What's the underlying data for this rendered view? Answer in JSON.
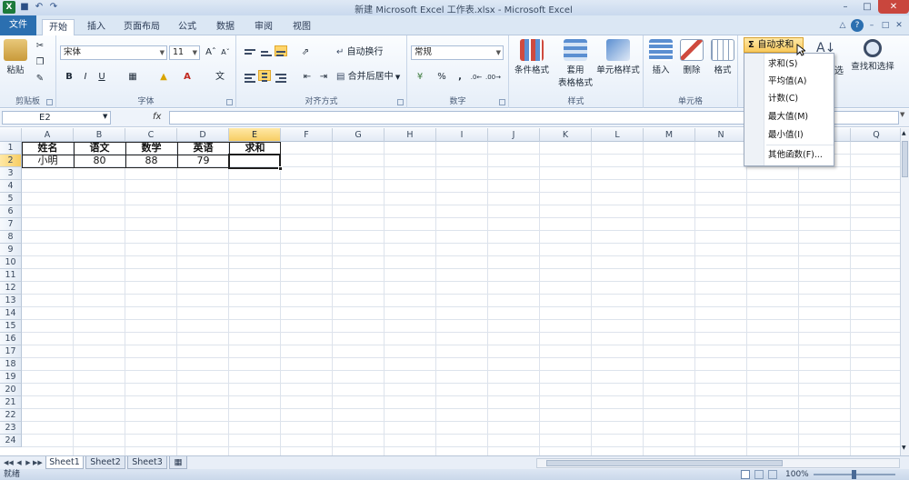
{
  "window": {
    "title": "新建 Microsoft Excel 工作表.xlsx - Microsoft Excel",
    "app_icon": "X",
    "quick_access": [
      "save-icon",
      "undo-icon",
      "redo-icon"
    ]
  },
  "tabs": [
    "文件",
    "开始",
    "插入",
    "页面布局",
    "公式",
    "数据",
    "审阅",
    "视图"
  ],
  "ribbon": {
    "clipboard": {
      "paste": "粘贴",
      "label": "剪贴板"
    },
    "font": {
      "name": "宋体",
      "size": "11",
      "label": "字体",
      "bold": "B",
      "italic": "I",
      "underline": "U"
    },
    "alignment": {
      "wrap": "自动换行",
      "merge": "合并后居中",
      "label": "对齐方式"
    },
    "number": {
      "format": "常规",
      "percent": "%",
      "comma": ",",
      "label": "数字"
    },
    "styles": {
      "conditional": "条件格式",
      "table_1": "套用",
      "table_2": "表格格式",
      "cell_styles": "单元格样式",
      "label": "样式"
    },
    "cells": {
      "insert": "插入",
      "delete": "删除",
      "format": "格式",
      "label": "单元格"
    },
    "editing": {
      "autosum": "自动求和",
      "sort_filter": "选",
      "find_select": "查找和选择"
    }
  },
  "formula_bar": {
    "name_box": "E2",
    "fx": "fx",
    "formula": ""
  },
  "columns": [
    "A",
    "B",
    "C",
    "D",
    "E",
    "F",
    "G",
    "H",
    "I",
    "J",
    "K",
    "L",
    "M",
    "N",
    "O",
    "P",
    "Q"
  ],
  "rows": [
    "1",
    "2",
    "3",
    "4",
    "5",
    "6",
    "7",
    "8",
    "9",
    "10",
    "11",
    "12",
    "13",
    "14",
    "15",
    "16",
    "17",
    "18",
    "19",
    "20",
    "21",
    "22",
    "23",
    "24"
  ],
  "sheet": {
    "headers": [
      "姓名",
      "语文",
      "数学",
      "英语",
      "求和"
    ],
    "row2": [
      "小明",
      "80",
      "88",
      "79",
      ""
    ]
  },
  "autosum_menu": {
    "items": [
      "求和(S)",
      "平均值(A)",
      "计数(C)",
      "最大值(M)",
      "最小值(I)",
      "其他函数(F)..."
    ]
  },
  "sheet_tabs": [
    "Sheet1",
    "Sheet2",
    "Sheet3"
  ],
  "status": {
    "mode": "就绪",
    "zoom": "100%"
  },
  "colors": {
    "accent": "#2b6fb0",
    "selection": "#f7cd63",
    "file_tab": "#2b6fb0"
  }
}
